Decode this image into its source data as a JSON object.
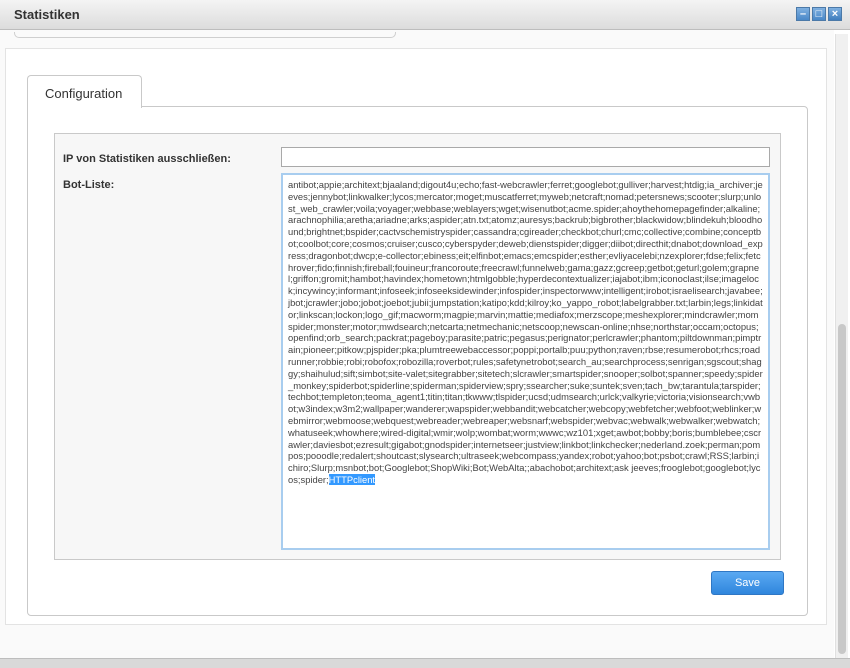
{
  "window": {
    "title": "Statistiken",
    "buttons": [
      "–",
      "□",
      "×"
    ]
  },
  "tabs": [
    {
      "label": "Configuration",
      "active": true
    }
  ],
  "form": {
    "ip_exclude_label": "IP von Statistiken ausschließen:",
    "ip_exclude_value": "",
    "bot_list_label": "Bot-Liste:",
    "bot_list_value": "antibot;appie;architext;bjaaland;digout4u;echo;fast-webcrawler;ferret;googlebot;gulliver;harvest;htdig;ia_archiver;jeeves;jennybot;linkwalker;lycos;mercator;moget;muscatferret;myweb;netcraft;nomad;petersnews;scooter;slurp;unlost_web_crawler;voila;voyager;webbase;weblayers;wget;wisenutbot;acme.spider;ahoythehomepagefinder;alkaline;arachnophilia;aretha;ariadne;arks;aspider;atn.txt;atomz;auresys;backrub;bigbrother;blackwidow;blindekuh;bloodhound;brightnet;bspider;cactvschemistryspider;cassandra;cgireader;checkbot;churl;cmc;collective;combine;conceptbot;coolbot;core;cosmos;cruiser;cusco;cyberspyder;deweb;dienstspider;digger;diibot;directhit;dnabot;download_express;dragonbot;dwcp;e-collector;ebiness;eit;elfinbot;emacs;emcspider;esther;evliyacelebi;nzexplorer;fdse;felix;fetchrover;fido;finnish;fireball;fouineur;francoroute;freecrawl;funnelweb;gama;gazz;gcreep;getbot;geturl;golem;grapnel;griffon;gromit;hambot;havindex;hometown;htmlgobble;hyperdecontextualizer;iajabot;ibm;iconoclast;ilse;imagelock;incywincy;informant;infoseek;infoseeksidewinder;infospider;inspectorwww;intelligent;irobot;israelisearch;javabee;jbot;jcrawler;jobo;jobot;joebot;jubii;jumpstation;katipo;kdd;kilroy;ko_yappo_robot;labelgrabber.txt;larbin;legs;linkidator;linkscan;lockon;logo_gif;macworm;magpie;marvin;mattie;mediafox;merzscope;meshexplorer;mindcrawler;momspider;monster;motor;mwdsearch;netcarta;netmechanic;netscoop;newscan-online;nhse;northstar;occam;octopus;openfind;orb_search;packrat;pageboy;parasite;patric;pegasus;perignator;perlcrawler;phantom;piltdownman;pimptrain;pioneer;pitkow;pjspider;pka;plumtreewebaccessor;poppi;portalb;puu;python;raven;rbse;resumerobot;rhcs;roadrunner;robbie;robi;robofox;robozilla;roverbot;rules;safetynetrobot;search_au;searchprocess;senrigan;sgscout;shaggy;shaihulud;sift;simbot;site-valet;sitegrabber;sitetech;slcrawler;smartspider;snooper;solbot;spanner;speedy;spider_monkey;spiderbot;spiderline;spiderman;spiderview;spry;ssearcher;suke;suntek;sven;tach_bw;tarantula;tarspider;techbot;templeton;teoma_agent1;titin;titan;tkwww;tlspider;ucsd;udmsearch;urlck;valkyrie;victoria;visionsearch;vwbot;w3index;w3m2;wallpaper;wanderer;wapspider;webbandit;webcatcher;webcopy;webfetcher;webfoot;weblinker;webmirror;webmoose;webquest;webreader;webreaper;websnarf;webspider;webvac;webwalk;webwalker;webwatch;whatuseek;whowhere;wired-digital;wmir;wolp;wombat;worm;wwwc;wz101;xget;awbot;bobby;boris;bumblebee;cscrawler;daviesbot;ezresult;gigabot;gnodspider;internetseer;justview;linkbot;linkchecker;nederland.zoek;perman;pompos;pooodle;redalert;shoutcast;slysearch;ultraseek;webcompass;yandex;robot;yahoo;bot;psbot;crawl;RSS;larbin;ichiro;Slurp;msnbot;bot;Googlebot;ShopWiki;Bot;WebAlta;;abachobot;architext;ask jeeves;frooglebot;googlebot;lycos;spider;",
    "bot_list_selected": "HTTPclient"
  },
  "actions": {
    "save_label": "Save"
  },
  "colors": {
    "accent": "#3a8fe0",
    "selection": "#3399ff"
  }
}
